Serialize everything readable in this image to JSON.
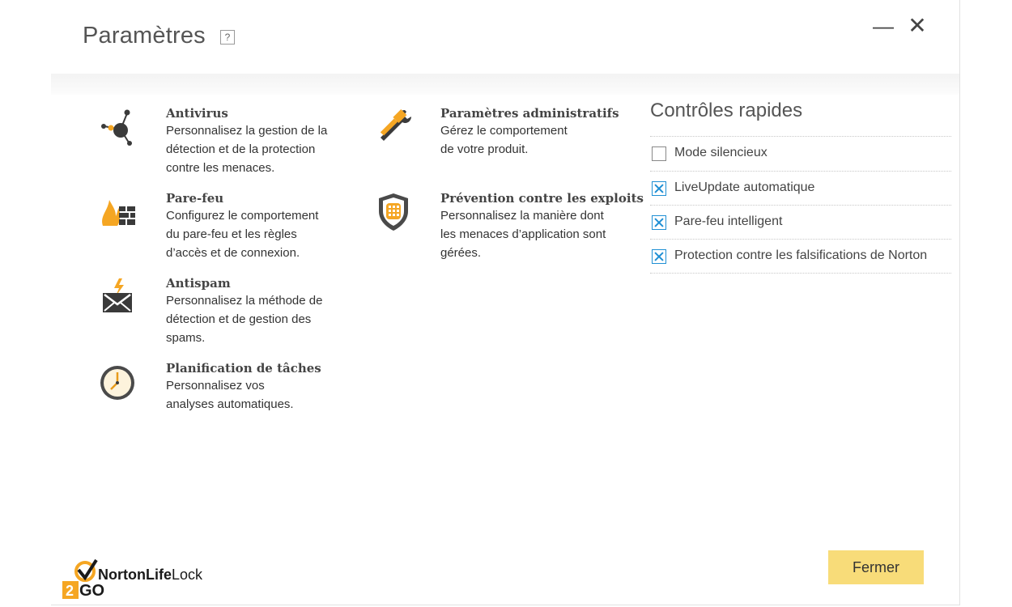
{
  "window": {
    "title": "Paramètres",
    "help_label": "?",
    "minimize_glyph": "—",
    "close_glyph": "✕"
  },
  "settings": [
    {
      "icon": "network-nodes-icon",
      "title": "Antivirus",
      "description": [
        "Personnalisez la gestion de la",
        "détection et de la protection",
        "contre les menaces."
      ]
    },
    {
      "icon": "firewall-flame-icon",
      "title": "Pare-feu",
      "description": [
        "Configurez le comportement",
        "du pare-feu et les règles",
        "d’accès et de connexion."
      ]
    },
    {
      "icon": "spam-envelope-icon",
      "title": "Antispam",
      "description": [
        "Personnalisez la méthode de",
        "détection et de gestion des",
        "spams."
      ]
    },
    {
      "icon": "clock-icon",
      "title": "Planification de tâches",
      "description": [
        "Personnalisez vos",
        "analyses automatiques."
      ]
    },
    {
      "icon": "tools-icon",
      "title": "Paramètres administratifs",
      "description": [
        "Gérez le comportement",
        "de votre produit."
      ]
    },
    {
      "icon": "shield-grid-icon",
      "title": "Prévention contre les exploits",
      "description": [
        "Personnalisez la manière dont",
        "les menaces d’application sont",
        "gérées."
      ]
    }
  ],
  "quick_controls": {
    "title": "Contrôles rapides",
    "items": [
      {
        "label": "Mode silencieux",
        "checked": false
      },
      {
        "label": "LiveUpdate automatique",
        "checked": true
      },
      {
        "label": "Pare-feu intelligent",
        "checked": true
      },
      {
        "label": "Protection contre les falsifications de Norton",
        "checked": true
      }
    ]
  },
  "footer": {
    "close_label": "Fermer",
    "logo_text_a": "Norton",
    "logo_text_b": "Life",
    "logo_text_c": "Lock",
    "logo_badge_digit": "2",
    "logo_badge_text": "GO"
  },
  "colors": {
    "accent_yellow": "#f8dc79",
    "checkbox_blue": "#1e8fd4",
    "icon_orange": "#f5a623",
    "icon_dark": "#3a3a3a"
  }
}
